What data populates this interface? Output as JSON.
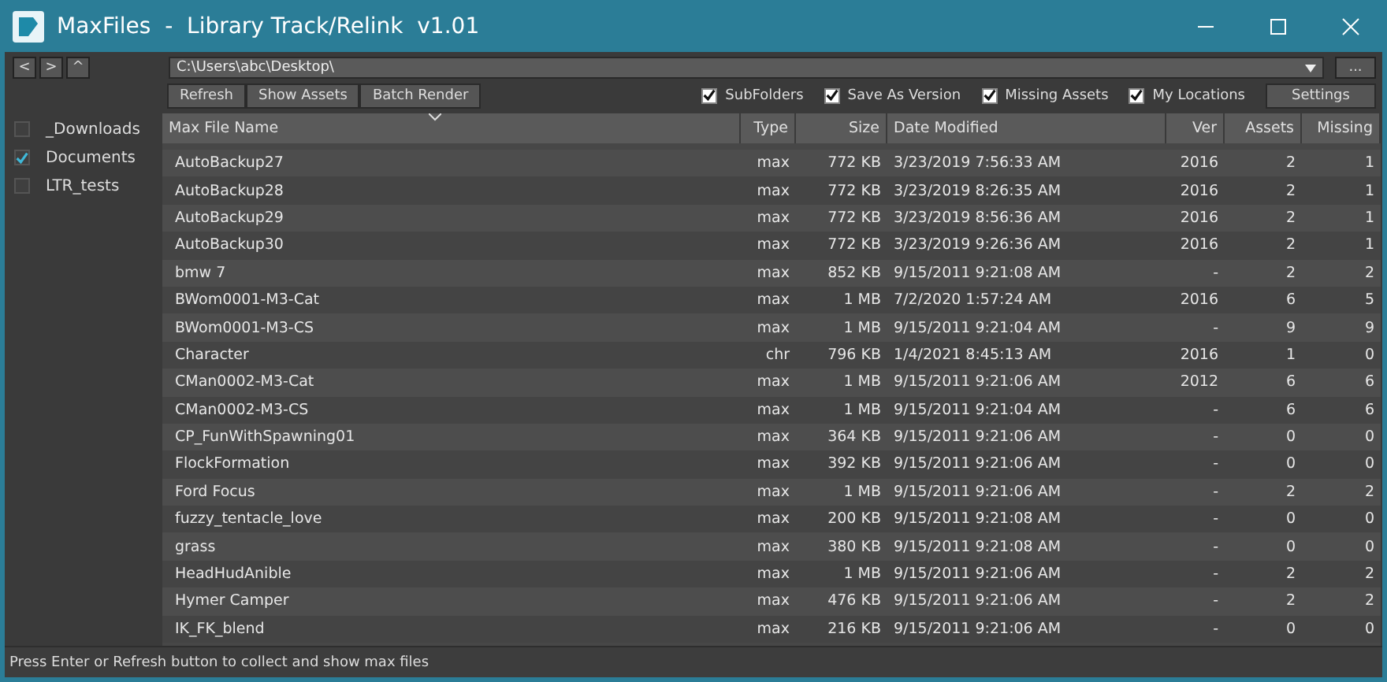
{
  "window": {
    "title": "MaxFiles  -  Library Track/Relink  v1.01"
  },
  "nav_buttons": [
    "<",
    ">",
    "^"
  ],
  "path": {
    "value": "C:\\Users\\abc\\Desktop\\"
  },
  "browse_button": "...",
  "actions": [
    "Refresh",
    "Show Assets",
    "Batch Render"
  ],
  "options": [
    {
      "label": "SubFolders",
      "checked": true
    },
    {
      "label": "Save As Version",
      "checked": true
    },
    {
      "label": "Missing Assets",
      "checked": true
    },
    {
      "label": "My Locations",
      "checked": true
    }
  ],
  "settings_button": "Settings",
  "locations": [
    {
      "label": "_Downloads",
      "checked": false
    },
    {
      "label": "Documents",
      "checked": true
    },
    {
      "label": "LTR_tests",
      "checked": false
    }
  ],
  "table": {
    "columns": [
      "Max File Name",
      "Type",
      "Size",
      "Date Modified",
      "Ver",
      "Assets",
      "Missing"
    ],
    "rows": [
      [
        "AutoBackup27",
        "max",
        "772 KB",
        "3/23/2019 7:56:33 AM",
        "2016",
        "2",
        "1"
      ],
      [
        "AutoBackup28",
        "max",
        "772 KB",
        "3/23/2019 8:26:35 AM",
        "2016",
        "2",
        "1"
      ],
      [
        "AutoBackup29",
        "max",
        "772 KB",
        "3/23/2019 8:56:36 AM",
        "2016",
        "2",
        "1"
      ],
      [
        "AutoBackup30",
        "max",
        "772 KB",
        "3/23/2019 9:26:36 AM",
        "2016",
        "2",
        "1"
      ],
      [
        "bmw 7",
        "max",
        "852 KB",
        "9/15/2011 9:21:08 AM",
        "-",
        "2",
        "2"
      ],
      [
        "BWom0001-M3-Cat",
        "max",
        "1 MB",
        "7/2/2020 1:57:24 AM",
        "2016",
        "6",
        "5"
      ],
      [
        "BWom0001-M3-CS",
        "max",
        "1 MB",
        "9/15/2011 9:21:04 AM",
        "-",
        "9",
        "9"
      ],
      [
        "Character",
        "chr",
        "796 KB",
        "1/4/2021 8:45:13 AM",
        "2016",
        "1",
        "0"
      ],
      [
        "CMan0002-M3-Cat",
        "max",
        "1 MB",
        "9/15/2011 9:21:06 AM",
        "2012",
        "6",
        "6"
      ],
      [
        "CMan0002-M3-CS",
        "max",
        "1 MB",
        "9/15/2011 9:21:04 AM",
        "-",
        "6",
        "6"
      ],
      [
        "CP_FunWithSpawning01",
        "max",
        "364 KB",
        "9/15/2011 9:21:06 AM",
        "-",
        "0",
        "0"
      ],
      [
        "FlockFormation",
        "max",
        "392 KB",
        "9/15/2011 9:21:06 AM",
        "-",
        "0",
        "0"
      ],
      [
        "Ford Focus",
        "max",
        "1 MB",
        "9/15/2011 9:21:06 AM",
        "-",
        "2",
        "2"
      ],
      [
        "fuzzy_tentacle_love",
        "max",
        "200 KB",
        "9/15/2011 9:21:08 AM",
        "-",
        "0",
        "0"
      ],
      [
        "grass",
        "max",
        "380 KB",
        "9/15/2011 9:21:08 AM",
        "-",
        "0",
        "0"
      ],
      [
        "HeadHudAnible",
        "max",
        "1 MB",
        "9/15/2011 9:21:06 AM",
        "-",
        "2",
        "2"
      ],
      [
        "Hymer Camper",
        "max",
        "476 KB",
        "9/15/2011 9:21:06 AM",
        "-",
        "2",
        "2"
      ],
      [
        "IK_FK_blend",
        "max",
        "216 KB",
        "9/15/2011 9:21:06 AM",
        "-",
        "0",
        "0"
      ]
    ]
  },
  "status_bar": "Press Enter or Refresh button to collect and show max files"
}
